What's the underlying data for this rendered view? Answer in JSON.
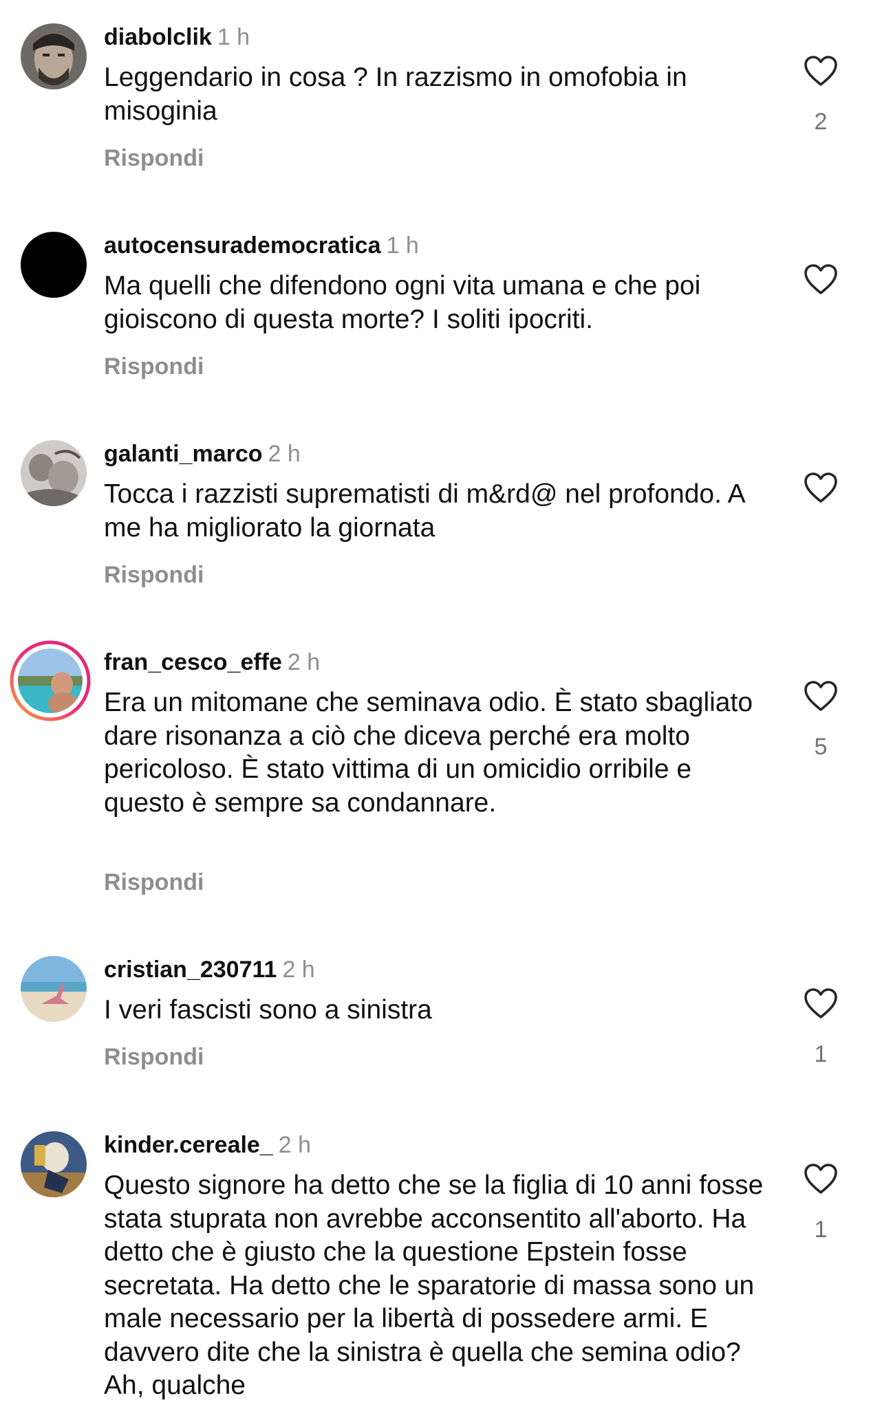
{
  "comments": [
    {
      "username": "diabolclik",
      "time": "1 h",
      "text": "Leggendario in cosa ? In razzismo in omofobia in misoginia",
      "reply_label": "Rispondi",
      "likes": "2"
    },
    {
      "username": "autocensurademocratica",
      "time": "1 h",
      "text": "Ma quelli che difendono ogni vita umana e che poi gioiscono di questa morte? I soliti ipocriti.",
      "reply_label": "Rispondi",
      "likes": ""
    },
    {
      "username": "galanti_marco",
      "time": "2 h",
      "text": "Tocca i razzisti suprematisti di m&rd@ nel profondo. A me ha migliorato la giornata",
      "reply_label": "Rispondi",
      "likes": ""
    },
    {
      "username": "fran_cesco_effe",
      "time": "2 h",
      "text": "Era un mitomane che seminava odio. È stato sbagliato dare risonanza a ciò che diceva perché era molto pericoloso. È stato vittima di un omicidio orribile e questo è sempre sa condannare.",
      "reply_label": "Rispondi",
      "likes": "5"
    },
    {
      "username": "cristian_230711",
      "time": "2 h",
      "text": "I veri fascisti sono a sinistra",
      "reply_label": "Rispondi",
      "likes": "1"
    },
    {
      "username": "kinder.cereale_",
      "time": "2 h",
      "text": "Questo signore ha detto che se la figlia di 10 anni fosse stata stuprata non avrebbe acconsentito all'aborto. Ha detto che è giusto che la questione Epstein fosse secretata. Ha detto che le sparatorie di massa sono un male necessario per la libertà di possedere armi. E davvero dite che la sinistra è quella che semina odio? Ah, qualche",
      "reply_label": "",
      "likes": "1"
    }
  ],
  "colors": {
    "text": "#111111",
    "muted": "#8e8e8e",
    "story_ring_start": "#f9a33a",
    "story_ring_end": "#d62976"
  },
  "icons": {
    "like": "heart-outline-icon"
  }
}
